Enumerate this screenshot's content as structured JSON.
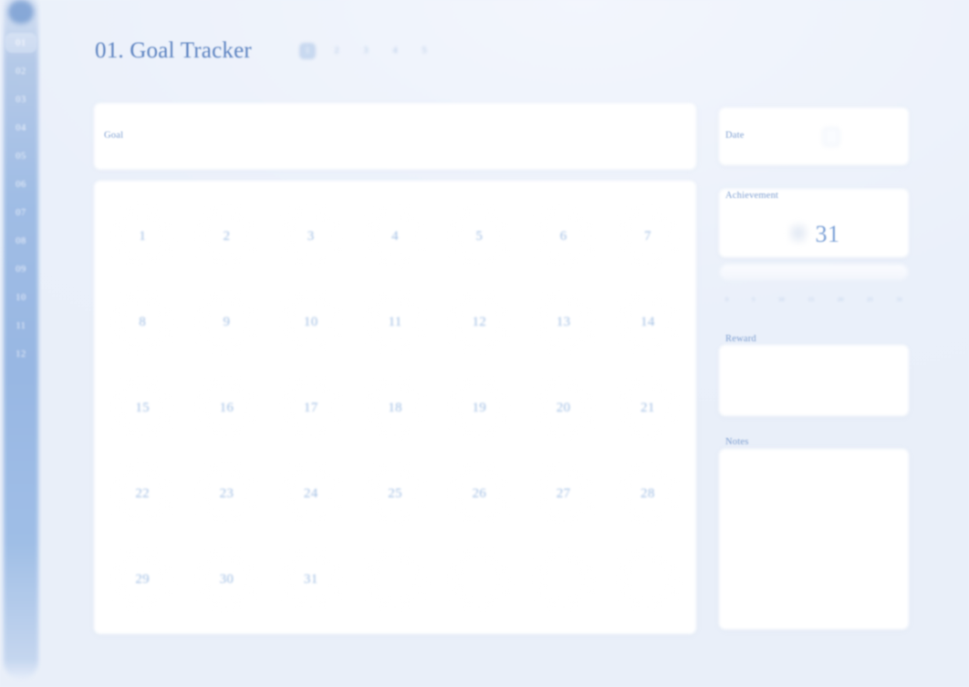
{
  "app": {
    "background_color": "#eef2fb",
    "accent_color": "#7ba0d6"
  },
  "sidebar": {
    "logo": "logo-dot",
    "items": [
      {
        "label": "01",
        "active": true
      },
      {
        "label": "02",
        "active": false
      },
      {
        "label": "03",
        "active": false
      },
      {
        "label": "04",
        "active": false
      },
      {
        "label": "05",
        "active": false
      },
      {
        "label": "06",
        "active": false
      },
      {
        "label": "07",
        "active": false
      },
      {
        "label": "08",
        "active": false
      },
      {
        "label": "09",
        "active": false
      },
      {
        "label": "10",
        "active": false
      },
      {
        "label": "11",
        "active": false
      },
      {
        "label": "12",
        "active": false
      }
    ]
  },
  "header": {
    "title": "01. Goal Tracker",
    "tabs": [
      {
        "label": "1",
        "active": true
      },
      {
        "label": "2",
        "active": false
      },
      {
        "label": "3",
        "active": false
      },
      {
        "label": "4",
        "active": false
      },
      {
        "label": "5",
        "active": false
      }
    ]
  },
  "goal": {
    "label": "Goal",
    "value": ""
  },
  "calendar": {
    "days": [
      "1",
      "2",
      "3",
      "4",
      "5",
      "6",
      "7",
      "8",
      "9",
      "10",
      "11",
      "12",
      "13",
      "14",
      "15",
      "16",
      "17",
      "18",
      "19",
      "20",
      "21",
      "22",
      "23",
      "24",
      "25",
      "26",
      "27",
      "28",
      "29",
      "30",
      "31",
      "",
      "",
      "",
      ""
    ]
  },
  "date": {
    "label": "Date",
    "value": "",
    "icon": "calendar-icon"
  },
  "achievement": {
    "label": "Achievement",
    "value": "31",
    "badge_icon": "trophy-icon",
    "scale": [
      "0",
      "5",
      "10",
      "15",
      "20",
      "25",
      "31"
    ]
  },
  "reward": {
    "label": "Reward",
    "value": ""
  },
  "notes": {
    "label": "Notes",
    "value": ""
  }
}
